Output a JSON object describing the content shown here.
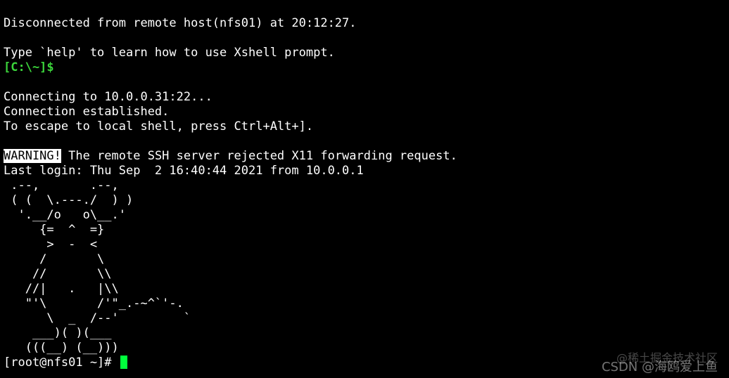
{
  "terminal": {
    "line_disconnect": "Disconnected from remote host(nfs01) at 20:12:27.",
    "line_help": "Type `help' to learn how to use Xshell prompt.",
    "local_prompt": "[C:\\~]$",
    "line_connecting": "Connecting to 10.0.0.31:22...",
    "line_established": "Connection established.",
    "line_escape": "To escape to local shell, press Ctrl+Alt+].",
    "warning_label": "WARNING!",
    "warning_text": " The remote SSH server rejected X11 forwarding request.",
    "last_login": "Last login: Thu Sep  2 16:40:44 2021 from 10.0.0.1",
    "ascii_art": [
      " .--,       .--,",
      " ( (  \\.---./  ) )",
      "  '.__/o   o\\__.'",
      "     {=  ^  =}",
      "      >  -  <",
      "     /       \\",
      "    //       \\\\",
      "   //|   .   |\\\\",
      "   \"'\\       /'\"_.-~^`'-.",
      "      \\  _  /--'         `",
      "    ___)( )(___",
      "   (((__) (__)))"
    ],
    "remote_prompt": "[root@nfs01 ~]# "
  },
  "watermark": {
    "community": "@稀土掘金技术社区",
    "author": "CSDN @海鸥爱上鱼"
  },
  "colors": {
    "background": "#000000",
    "foreground": "#ffffff",
    "prompt_green": "#3bd43b",
    "cursor_green": "#00ff3c"
  }
}
